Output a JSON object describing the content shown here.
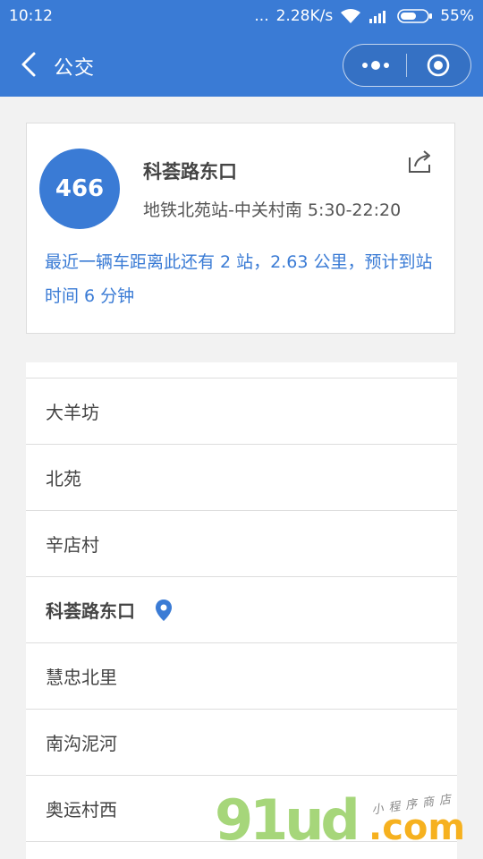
{
  "status_bar": {
    "time": "10:12",
    "dots": "...",
    "speed": "2.28K/s",
    "battery": "55%"
  },
  "nav": {
    "title": "公交",
    "icons": [
      "chevron-left-icon",
      "more-dots-icon",
      "close-target-icon"
    ]
  },
  "bus_card": {
    "route_number": "466",
    "stop_name": "科荟路东口",
    "route_info": "地铁北苑站-中关村南 5:30-22:20",
    "arrival_tip": "最近一辆车距离此还有 2 站，2.63 公里，预计到站时间 6 分钟",
    "accent_color": "#3a7bd5"
  },
  "stops": [
    {
      "name": "大羊坊",
      "current": false
    },
    {
      "name": "北苑",
      "current": false
    },
    {
      "name": "辛店村",
      "current": false
    },
    {
      "name": "科荟路东口",
      "current": true
    },
    {
      "name": "慧忠北里",
      "current": false
    },
    {
      "name": "南沟泥河",
      "current": false
    },
    {
      "name": "奥运村西",
      "current": false
    }
  ],
  "watermark": {
    "main": "91ud",
    "domain": ".com",
    "tagline": "小程序商店"
  }
}
